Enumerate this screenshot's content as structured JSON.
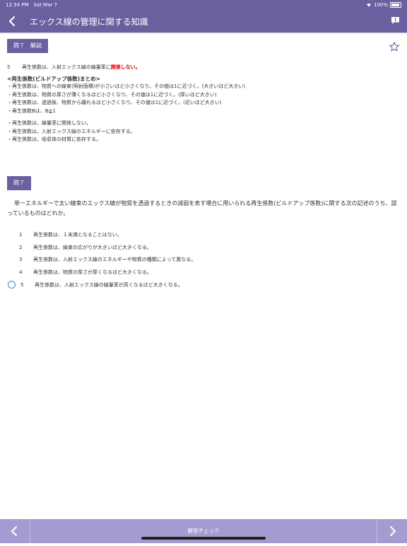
{
  "status": {
    "time": "12:34 PM",
    "date": "Sat Mar 7",
    "battery": "100%"
  },
  "nav": {
    "title": "エックス線の管理に関する知識",
    "back_icon": "chevron-left-icon",
    "chat_icon": "chat-bubble-icon"
  },
  "explanation": {
    "tag": "問７　解説",
    "answer_number": "5",
    "answer_text_before": "再生係数は、入射エックス線の線量率に",
    "answer_text_emphasis": "関係しない。",
    "answer_emphasis_color": "#d90000",
    "heading": "<再生係数(ビルドアップ係数)まとめ>",
    "lines_a": [
      "・再生係数は、物質への線束(照射面積)が小さいほど小さくなり、その値は1に近づく。(大きいほど大きい)",
      "・再生係数は、物質の厚さが薄くなるほど小さくなり、その値は1に近づく。(厚いほど大きい)",
      "・再生係数は、透過後、物質から離れるほど小さくなり、その値は1に近づく。(近いほど大きい)",
      "・再生係数Bは、B≧1"
    ],
    "lines_b": [
      "・再生係数は、線量率に関係しない。",
      "・再生係数は、入射エックス線のエネルギーに依存する。",
      "・再生係数は、吸収体の材質に依存する。"
    ]
  },
  "question": {
    "tag": "問７",
    "text": "単一エネルギーで太い線束のエックス線が物質を透過するときの減弱を表す場合に用いられる再生係数(ビルドアップ係数)に関する次の記述のうち、誤っているものはどれか。",
    "choices": [
      {
        "number": "1",
        "text": "再生係数は、１未満となることはない。",
        "selected": false
      },
      {
        "number": "2",
        "text": "再生係数は、線束の広がりが大きいほど大きくなる。",
        "selected": false
      },
      {
        "number": "3",
        "text": "再生係数は、入射エックス線のエネルギーや物質の種類によって異なる。",
        "selected": false
      },
      {
        "number": "4",
        "text": "再生係数は、物質の厚さが厚くなるほど大きくなる。",
        "selected": false
      },
      {
        "number": "5",
        "text": "再生係数は、入射エックス線の線量率が高くなるほど大きくなる。",
        "selected": true
      }
    ]
  },
  "toolbar": {
    "check_label": "解答チェック",
    "prev_icon": "chevron-left-icon",
    "next_icon": "chevron-right-icon"
  },
  "colors": {
    "header": "#6b5fa0",
    "toolbar": "#a69bd1",
    "radio": "#2d8be5"
  }
}
